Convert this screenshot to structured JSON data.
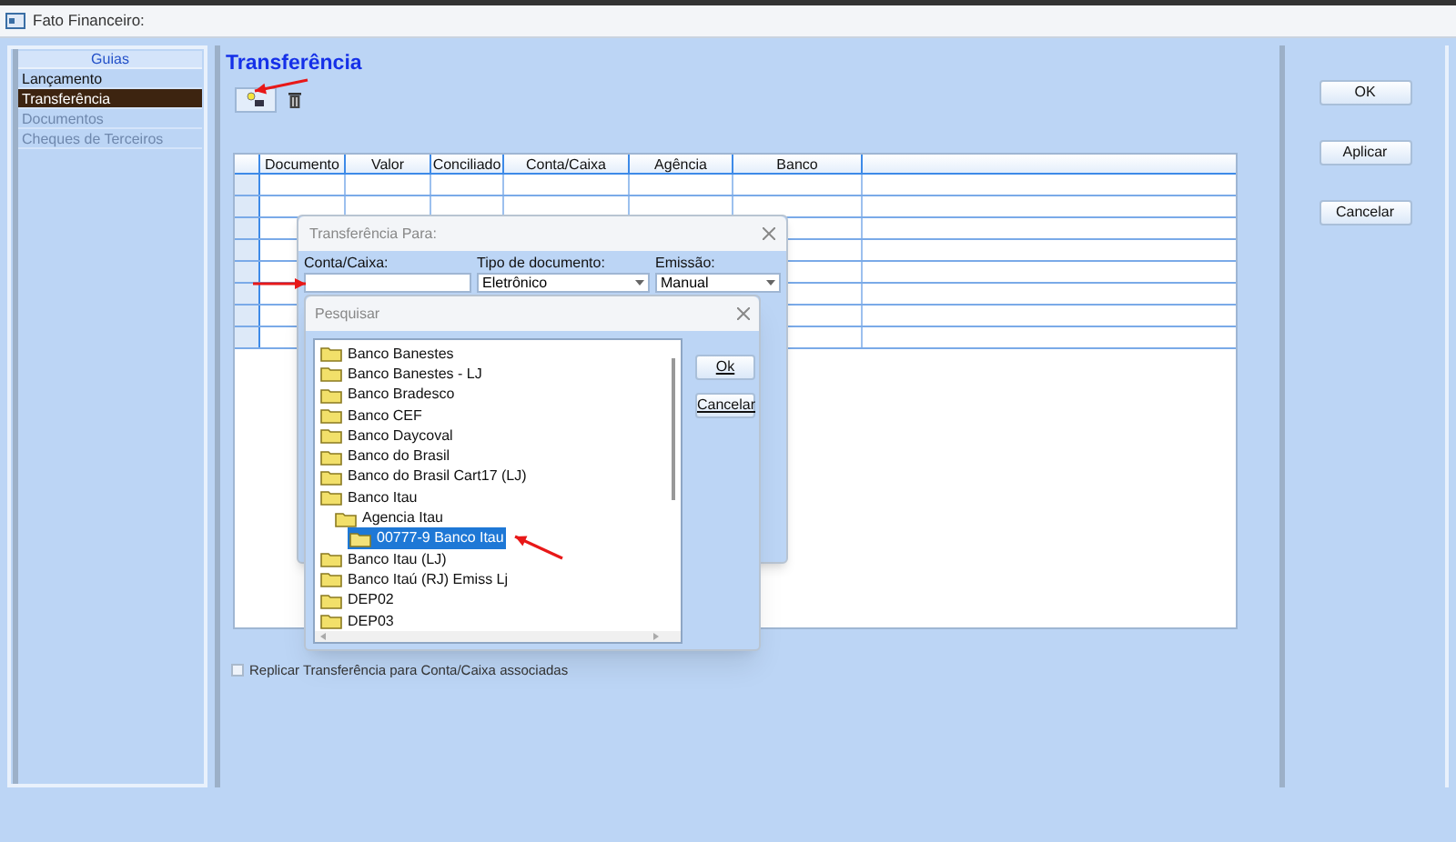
{
  "window": {
    "title": "Fato Financeiro:"
  },
  "sidebar": {
    "title": "Guias",
    "items": [
      {
        "label": "Lançamento",
        "selected": false,
        "disabled": false
      },
      {
        "label": "Transferência",
        "selected": true,
        "disabled": false
      },
      {
        "label": "Documentos",
        "selected": false,
        "disabled": true
      },
      {
        "label": "Cheques de Terceiros",
        "selected": false,
        "disabled": true
      }
    ]
  },
  "content": {
    "title": "Transferência",
    "table": {
      "columns": [
        "Documento",
        "Valor",
        "Conciliado",
        "Conta/Caixa",
        "Agência",
        "Banco"
      ]
    },
    "replicate": {
      "label": "Replicar Transferência para Conta/Caixa associadas",
      "checked": false
    }
  },
  "actions": [
    "OK",
    "Aplicar",
    "Cancelar"
  ],
  "transfer_dialog": {
    "title": "Transferência Para:",
    "fields": [
      {
        "label": "Conta/Caixa:",
        "kind": "text"
      },
      {
        "label": "Tipo de documento:",
        "kind": "select",
        "value": "Eletrônico"
      },
      {
        "label": "Emissão:",
        "kind": "select",
        "value": "Manual"
      }
    ]
  },
  "search_dialog": {
    "title": "Pesquisar",
    "buttons": [
      "Ok",
      "Cancelar"
    ],
    "tree": [
      {
        "label": "Banco Banestes",
        "selected": false
      },
      {
        "label": "Banco Banestes - LJ",
        "selected": false
      },
      {
        "label": "Banco Bradesco",
        "selected": false
      },
      {
        "label": "Banco CEF",
        "selected": false
      },
      {
        "label": "Banco Daycoval",
        "selected": false
      },
      {
        "label": "Banco do Brasil",
        "selected": false
      },
      {
        "label": "Banco do Brasil Cart17 (LJ)",
        "selected": false
      },
      {
        "label": "Banco Itau",
        "selected": false,
        "children": [
          {
            "label": "Agencia Itau",
            "selected": false,
            "children": [
              {
                "label": "00777-9 Banco Itau",
                "selected": true
              }
            ]
          }
        ]
      },
      {
        "label": "Banco Itau (LJ)",
        "selected": false
      },
      {
        "label": "Banco Itaú (RJ) Emiss Lj",
        "selected": false
      },
      {
        "label": "DEP02",
        "selected": false
      },
      {
        "label": "DEP03",
        "selected": false
      }
    ]
  }
}
